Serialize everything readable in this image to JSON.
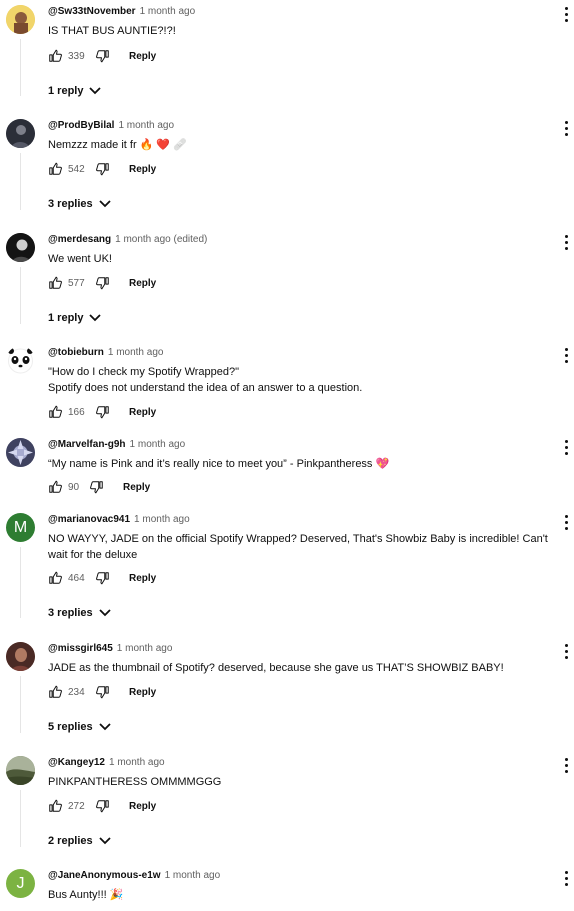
{
  "comments": [
    {
      "author": "@Sw33tNovember",
      "time": "1 month ago",
      "lines": [
        "IS THAT BUS AUNTIE?!?!"
      ],
      "likes": "339",
      "reply_label": "Reply",
      "replies": "1 reply",
      "avatar_color": "#e8c84a"
    },
    {
      "author": "@ProdByBilal",
      "time": "1 month ago",
      "lines": [
        "Nemzzz made it fr 🔥 ❤️ 🩹"
      ],
      "likes": "542",
      "reply_label": "Reply",
      "replies": "3 replies",
      "avatar_color": "#3a3d4a"
    },
    {
      "author": "@merdesang",
      "time": "1 month ago (edited)",
      "lines": [
        "We went UK!"
      ],
      "likes": "577",
      "reply_label": "Reply",
      "replies": "1 reply",
      "avatar_color": "#1c1c1c"
    },
    {
      "author": "@tobieburn",
      "time": "1 month ago",
      "lines": [
        "\"How do I check my Spotify Wrapped?\"",
        "Spotify does not understand the idea of an answer to a question."
      ],
      "likes": "166",
      "reply_label": "Reply",
      "replies": "",
      "avatar_color": "#ffffff"
    },
    {
      "author": "@Marvelfan-g9h",
      "time": "1 month ago",
      "lines": [
        "“My name is Pink and it’s really nice to meet you” - Pinkpantheress 💖"
      ],
      "likes": "90",
      "reply_label": "Reply",
      "replies": "",
      "avatar_color": "#5a5e7a"
    },
    {
      "author": "@marianovac941",
      "time": "1 month ago",
      "lines": [
        "NO WAYYY, JADE on the official Spotify Wrapped? Deserved, That's Showbiz Baby is incredible! Can't wait for the deluxe"
      ],
      "likes": "464",
      "reply_label": "Reply",
      "replies": "3 replies",
      "avatar_color": "#2e7d32",
      "avatar_letter": "M"
    },
    {
      "author": "@missgirl645",
      "time": "1 month ago",
      "lines": [
        "JADE as the thumbnail of Spotify? deserved, because she gave us THAT’S SHOWBIZ BABY!"
      ],
      "likes": "234",
      "reply_label": "Reply",
      "replies": "5 replies",
      "avatar_color": "#6b3d34"
    },
    {
      "author": "@Kangey12",
      "time": "1 month ago",
      "lines": [
        "PINKPANTHERESS OMMMMGGG"
      ],
      "likes": "272",
      "reply_label": "Reply",
      "replies": "2 replies",
      "avatar_color": "#6b7a55"
    },
    {
      "author": "@JaneAnonymous-e1w",
      "time": "1 month ago",
      "lines": [
        "Bus Aunty!!! 🎉"
      ],
      "likes": "",
      "reply_label": "",
      "replies": "",
      "avatar_color": "#7cb342",
      "avatar_letter": "J"
    }
  ]
}
